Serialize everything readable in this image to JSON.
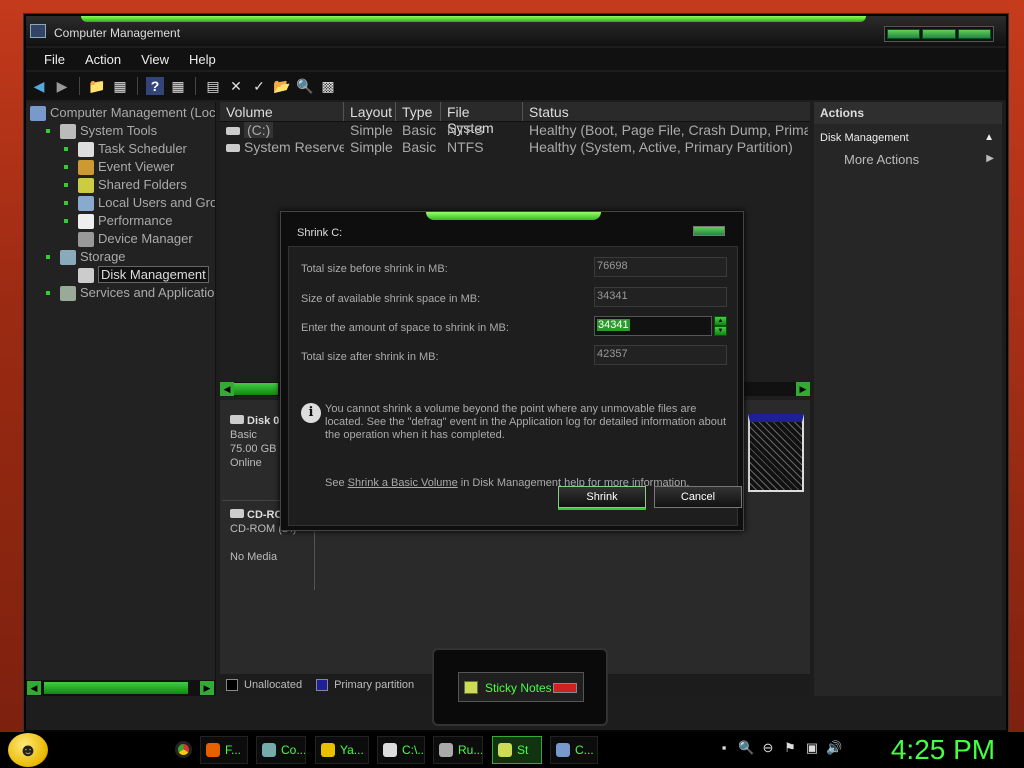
{
  "window": {
    "title": "Computer Management"
  },
  "menu": [
    "File",
    "Action",
    "View",
    "Help"
  ],
  "tree": [
    {
      "label": "Computer Management (Loc",
      "level": 0,
      "icon": "computer-icon",
      "bullet": false
    },
    {
      "label": "System Tools",
      "level": 1,
      "icon": "tools-icon",
      "bullet": true
    },
    {
      "label": "Task Scheduler",
      "level": 2,
      "icon": "clock-icon",
      "bullet": true
    },
    {
      "label": "Event Viewer",
      "level": 2,
      "icon": "event-viewer-icon",
      "bullet": true
    },
    {
      "label": "Shared Folders",
      "level": 2,
      "icon": "shared-folder-icon",
      "bullet": true
    },
    {
      "label": "Local Users and Grou",
      "level": 2,
      "icon": "users-icon",
      "bullet": true
    },
    {
      "label": "Performance",
      "level": 2,
      "icon": "performance-icon",
      "bullet": true
    },
    {
      "label": "Device Manager",
      "level": 2,
      "icon": "device-manager-icon",
      "bullet": false
    },
    {
      "label": "Storage",
      "level": 1,
      "icon": "storage-icon",
      "bullet": true
    },
    {
      "label": "Disk Management",
      "level": 2,
      "icon": "disk-icon",
      "bullet": false,
      "selected": true
    },
    {
      "label": "Services and Application:",
      "level": 1,
      "icon": "services-icon",
      "bullet": true
    }
  ],
  "volumes": {
    "columns": [
      "Volume",
      "Layout",
      "Type",
      "File System",
      "Status"
    ],
    "rows": [
      [
        "(C:)",
        "Simple",
        "Basic",
        "NTFS",
        "Healthy (Boot, Page File, Crash Dump, Primary"
      ],
      [
        "System Reserved",
        "Simple",
        "Basic",
        "NTFS",
        "Healthy (System, Active, Primary Partition)"
      ]
    ]
  },
  "disks": [
    {
      "name": "Disk 0",
      "line1": "Basic",
      "line2": "75.00 GB",
      "line3": "Online"
    },
    {
      "name": "CD-RO",
      "line1": "CD-ROM (D:)",
      "line2": "",
      "line3": "No Media"
    }
  ],
  "legend": {
    "unallocated": "Unallocated",
    "primary": "Primary partition"
  },
  "actions": {
    "header": "Actions",
    "item": "Disk Management",
    "more": "More Actions"
  },
  "dialog": {
    "title": "Shrink C:",
    "total_label": "Total size before shrink in MB:",
    "total_value": "76698",
    "avail_label": "Size of available shrink space in MB:",
    "avail_value": "34341",
    "enter_label": "Enter the amount of space to shrink in MB:",
    "enter_value": "34341",
    "after_label": "Total size after shrink in MB:",
    "after_value": "42357",
    "note": "You cannot shrink a volume beyond the point where any unmovable files are located. See the \"defrag\" event in the Application log for detailed information about the operation when it has completed.",
    "see_pre": "See ",
    "see_link": "Shrink a Basic Volume",
    "see_post": " in Disk Management help for more information.",
    "shrink": "Shrink",
    "cancel": "Cancel"
  },
  "sticky": {
    "label": "Sticky Notes"
  },
  "taskbar": {
    "buttons": [
      {
        "label": "F...",
        "icon": "firefox-icon",
        "color": "#e66000"
      },
      {
        "label": "Co...",
        "icon": "computer-icon",
        "color": "#7aa"
      },
      {
        "label": "Ya...",
        "icon": "yahoo-icon",
        "color": "#e8c000"
      },
      {
        "label": "C:\\...",
        "icon": "cmd-icon",
        "color": "#ddd"
      },
      {
        "label": "Ru...",
        "icon": "run-icon",
        "color": "#aaa"
      },
      {
        "label": "St",
        "icon": "sticky-notes-icon",
        "color": "#cd5",
        "active": true
      },
      {
        "label": "C...",
        "icon": "computer-management-icon",
        "color": "#79c"
      }
    ],
    "clock": "4:25 PM"
  }
}
